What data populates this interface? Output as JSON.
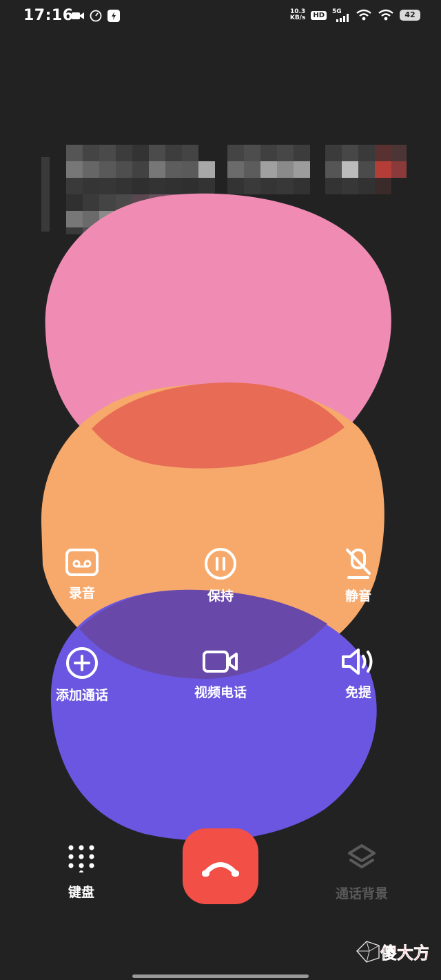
{
  "status_bar": {
    "time": "17:16",
    "net_speed_value": "10.3",
    "net_speed_unit": "KB/s",
    "hd": "HD",
    "network": "5G",
    "battery": "42"
  },
  "controls": [
    {
      "label": "录音",
      "icon": "record-icon"
    },
    {
      "label": "保持",
      "icon": "pause-icon"
    },
    {
      "label": "静音",
      "icon": "mute-mic-icon"
    },
    {
      "label": "添加通话",
      "icon": "add-call-icon"
    },
    {
      "label": "视频电话",
      "icon": "video-camera-icon"
    },
    {
      "label": "免提",
      "icon": "speaker-icon"
    }
  ],
  "bottom": {
    "keypad_label": "键盘",
    "background_label": "通话背景",
    "hangup_icon": "hangup-icon"
  },
  "colors": {
    "background": "#222222",
    "pink_blob": "#f08cb3",
    "orange_blob": "#f6a96b",
    "purple_blob": "#6a56e0",
    "hangup": "#f24f47"
  }
}
